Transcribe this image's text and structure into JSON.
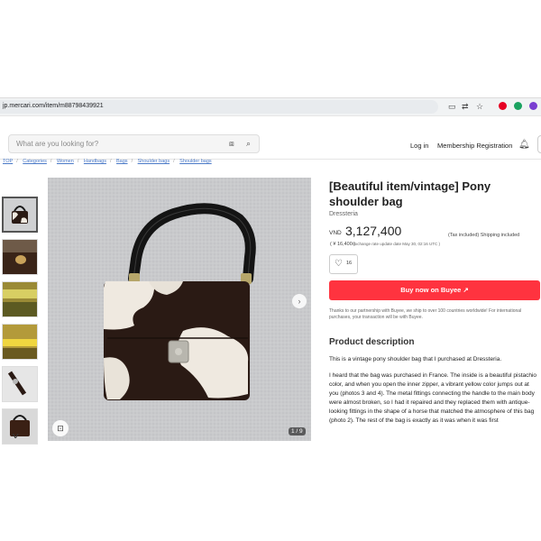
{
  "browser": {
    "url": "jp.mercari.com/item/m88798439921"
  },
  "header": {
    "search_placeholder": "What are you looking for?",
    "login": "Log in",
    "membership": "Membership Registration"
  },
  "breadcrumbs": [
    "TOP",
    "Categories",
    "Women",
    "Handbags",
    "Bags",
    "Shoulder bags",
    "Shoulder bags"
  ],
  "gallery": {
    "counter": "1 / 9"
  },
  "product": {
    "title": "[Beautiful item/vintage] Pony shoulder bag",
    "shop": "Dressteria",
    "currency": "VND",
    "price": "3,127,400",
    "tax_note": "(Tax included) Shipping included",
    "yen_price": "( ¥ 16,400 )",
    "rate_note": "Exchange rate update date May 30, 02:16 UTC )",
    "likes": "16",
    "buy_label": "Buy now on Buyee ↗",
    "partner_note": "Thanks to our partnership with Buyee, we ship to over 100 countries worldwide! For international purchases, your transaction will be with Buyee."
  },
  "description": {
    "heading": "Product description",
    "intro": "This is a vintage pony shoulder bag that I purchased at Dressteria.",
    "body": "I heard that the bag was purchased in France. The inside is a beautiful pistachio color, and when you open the inner zipper, a vibrant yellow color jumps out at you (photos 3 and 4). The metal fittings connecting the handle to the main body were almost broken, so I had it repaired and they replaced them with antique-looking fittings in the shape of a horse that matched the atmosphere of this bag (photo 2). The rest of the bag is exactly as it was when it was first"
  },
  "colors": {
    "buy_button": "#ff333f",
    "link": "#4a79c7",
    "bag_dark": "#2a1a14",
    "bag_light": "#efe9e0"
  }
}
